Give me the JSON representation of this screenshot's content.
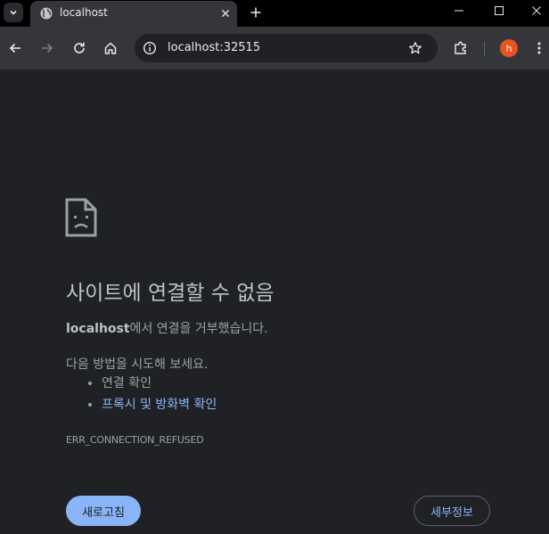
{
  "browser": {
    "tab": {
      "title": "localhost",
      "favicon": "globe-icon"
    },
    "new_tab_icon": "plus-icon",
    "omnibox": {
      "url": "localhost:32515",
      "info_icon": "info-icon",
      "bookmark_icon": "star-icon"
    },
    "profile": {
      "initial": "h",
      "color": "#e8531f"
    },
    "toolbar_icons": [
      "back-arrow-icon",
      "forward-arrow-icon",
      "reload-icon",
      "home-icon",
      "extensions-icon",
      "more-vert-icon"
    ]
  },
  "error": {
    "icon": "sad-page-icon",
    "title": "사이트에 연결할 수 없음",
    "host": "localhost",
    "description_suffix": "에서 연결을 거부했습니다.",
    "suggestions_heading": "다음 방법을 시도해 보세요.",
    "suggestions": [
      {
        "label": "연결 확인",
        "link": false
      },
      {
        "label": "프록시 및 방화벽 확인",
        "link": true
      }
    ],
    "code": "ERR_CONNECTION_REFUSED",
    "reload_label": "새로고침",
    "details_label": "세부정보"
  },
  "colors": {
    "page_background": "#202124",
    "toolbar_background": "#35363a",
    "accent": "#8ab4f8"
  }
}
